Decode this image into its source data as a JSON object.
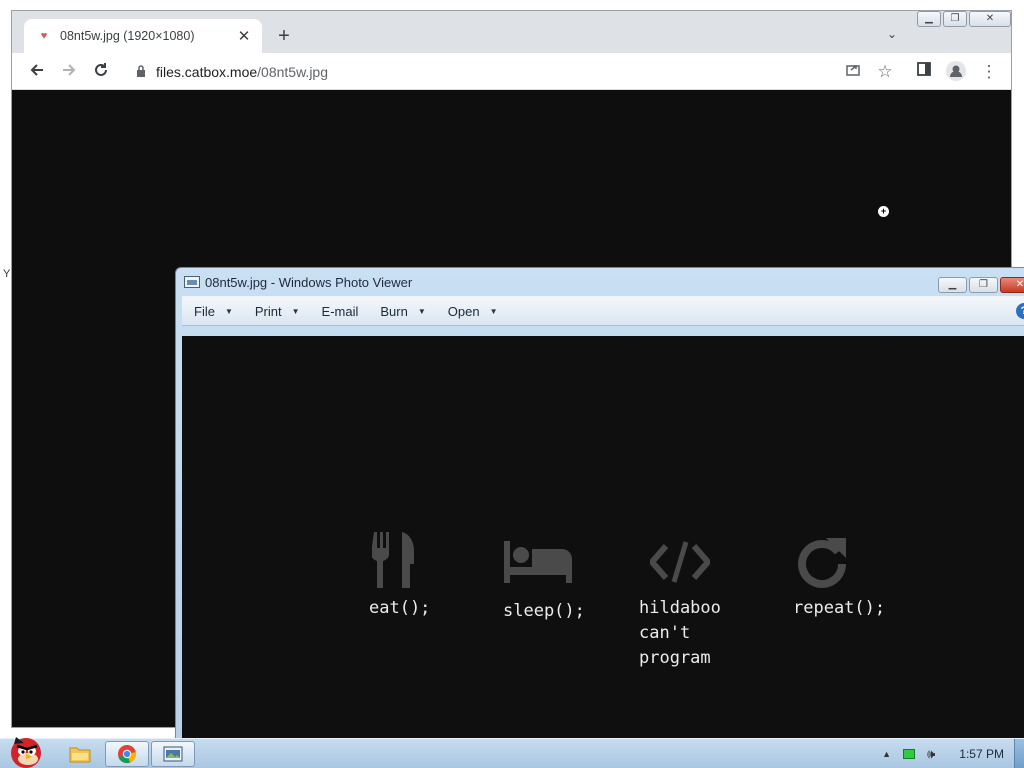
{
  "browser": {
    "tab_title": "08nt5w.jpg (1920×1080)",
    "tab_close_glyph": "✕",
    "new_tab_glyph": "+",
    "tab_search_glyph": "⌄",
    "url_host": "files.catbox.moe",
    "url_path": "/08nt5w.jpg",
    "nav_icons": [
      "back-arrow-icon",
      "forward-arrow-icon",
      "reload-icon"
    ],
    "toolbar_icons": [
      "share-icon",
      "bookmark-star-icon",
      "side-panel-icon",
      "profile-icon",
      "menu-kebab-icon"
    ]
  },
  "desktop": {
    "edge_glyph": "Y"
  },
  "photo_viewer": {
    "title": "08nt5w.jpg - Windows Photo Viewer",
    "menus": [
      {
        "label": "File",
        "has_dropdown": true
      },
      {
        "label": "Print",
        "has_dropdown": true
      },
      {
        "label": "E-mail",
        "has_dropdown": false
      },
      {
        "label": "Burn",
        "has_dropdown": true
      },
      {
        "label": "Open",
        "has_dropdown": true
      }
    ],
    "help_glyph": "?",
    "image": {
      "items": [
        {
          "icon": "fork-knife-icon",
          "label": "eat();"
        },
        {
          "icon": "bed-icon",
          "label": "sleep();"
        },
        {
          "icon": "code-brackets-icon",
          "label": "hildaboo\ncan't\nprogram"
        },
        {
          "icon": "repeat-arrow-icon",
          "label": "repeat();"
        }
      ]
    }
  },
  "taskbar": {
    "clock": "1:57 PM",
    "tray_arrow_glyph": "▲",
    "volume_glyph": "🕪",
    "apps": [
      "angry-birds-start-icon",
      "file-explorer-icon",
      "chrome-icon",
      "photo-viewer-icon"
    ]
  },
  "colors": {
    "image_background": "#0f0f0f",
    "image_icon_gray": "#4a4a4a",
    "image_text": "#ececec",
    "taskbar_blue": "#b8d1ea"
  }
}
